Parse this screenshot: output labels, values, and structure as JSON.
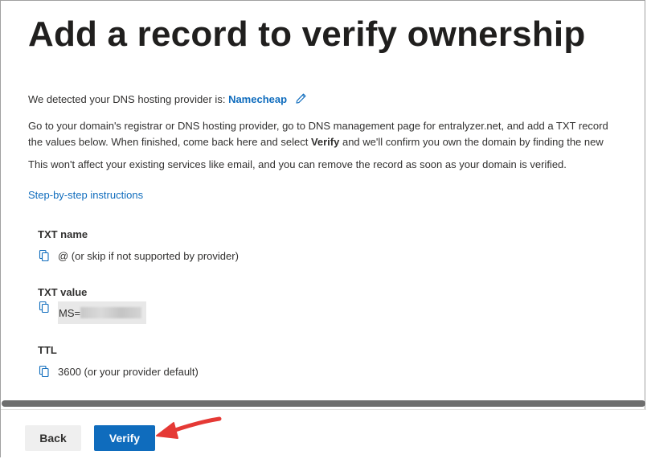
{
  "page": {
    "title": "Add a record to verify ownership"
  },
  "intro": {
    "detected_prefix": "We detected your DNS hosting provider is:",
    "provider_name": "Namecheap",
    "instructions_line1_pre": "Go to your domain's registrar or DNS hosting provider, go to DNS management page for entralyzer.net, and add a TXT record",
    "instructions_line2_pre": "the values below. When finished, come back here and select ",
    "instructions_line2_bold": "Verify",
    "instructions_line2_post": " and we'll confirm you own the domain by finding the new",
    "note": "This won't affect your existing services like email, and you can remove the record as soon as your domain is verified."
  },
  "links": {
    "step_by_step": "Step-by-step instructions"
  },
  "fields": {
    "txt_name": {
      "label": "TXT name",
      "value": "@ (or skip if not supported by provider)"
    },
    "txt_value": {
      "label": "TXT value",
      "value_prefix": "MS="
    },
    "ttl": {
      "label": "TTL",
      "value": "3600 (or your provider default)"
    }
  },
  "footer": {
    "back_label": "Back",
    "verify_label": "Verify"
  },
  "icons": {
    "edit": "pencil-icon",
    "copy": "copy-icon",
    "annotation": "red-arrow"
  },
  "colors": {
    "link": "#0f6cbd",
    "primary_button": "#0f6cbd",
    "secondary_button": "#efefef",
    "annotation_arrow": "#e53935"
  }
}
